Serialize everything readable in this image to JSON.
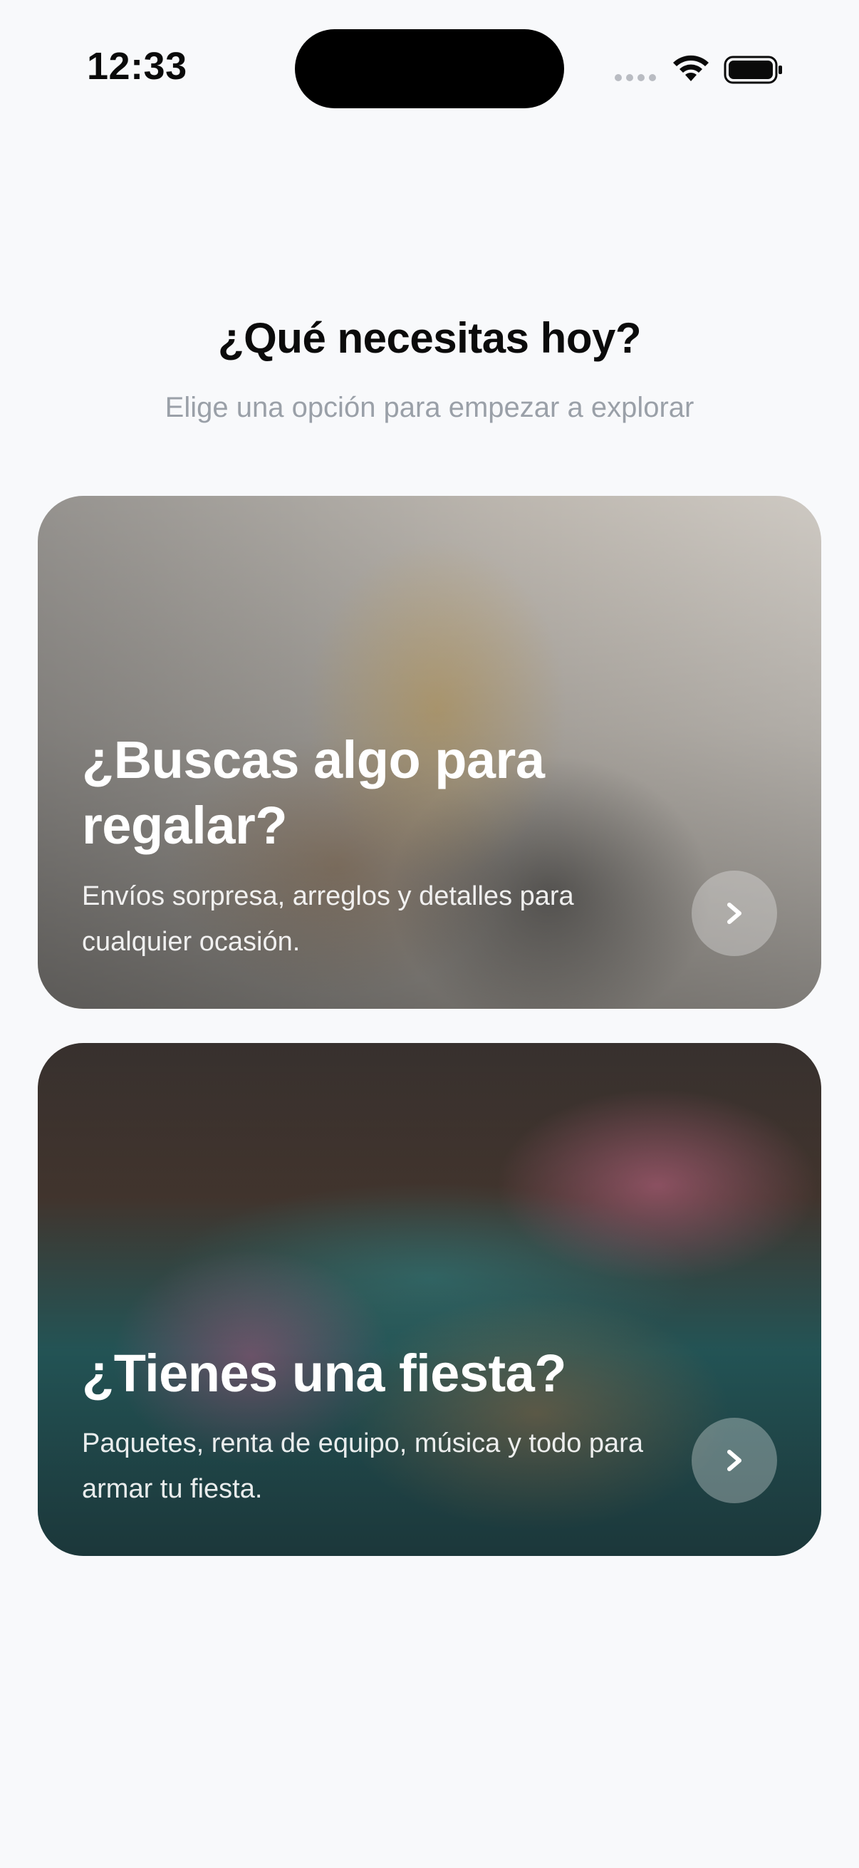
{
  "status_bar": {
    "time": "12:33"
  },
  "header": {
    "title": "¿Qué necesitas hoy?",
    "subtitle": "Elige una opción para empezar a explorar"
  },
  "options": [
    {
      "title": "¿Buscas algo para regalar?",
      "description": "Envíos sorpresa, arreglos y detalles para cualquier ocasión.",
      "icon": "chevron-right-icon"
    },
    {
      "title": "¿Tienes una fiesta?",
      "description": "Paquetes, renta de equipo, música y todo para armar tu fiesta.",
      "icon": "chevron-right-icon"
    }
  ],
  "colors": {
    "background": "#f8f9fb",
    "title": "#0b0b0b",
    "subtitle": "#9aa0a8",
    "card_text": "#ffffff"
  }
}
